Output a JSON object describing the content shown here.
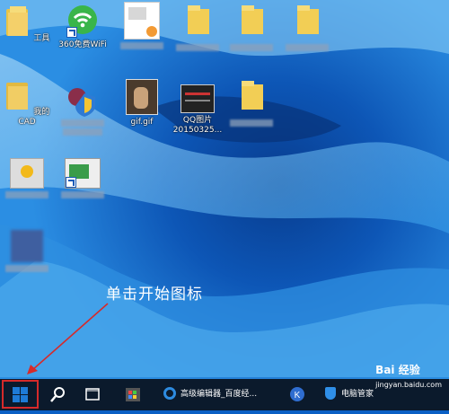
{
  "desktop": {
    "icons": [
      {
        "name": "folder-gongju",
        "label": "工具"
      },
      {
        "name": "wifi-360",
        "label": "360免费WiFi"
      },
      {
        "name": "my-cad",
        "label": "我的CAD"
      },
      {
        "name": "gif-file",
        "label": "gif.gif"
      },
      {
        "name": "qq-image",
        "label_line1": "QQ图片",
        "label_line2": "20150325..."
      }
    ]
  },
  "annotation": {
    "text": "单击开始图标"
  },
  "taskbar": {
    "browser_tab": "高级编辑器_百度经...",
    "security_tab": "电脑管家"
  },
  "watermark": {
    "text": "Bai 经验",
    "url": "jingyan.baidu.com"
  },
  "colors": {
    "taskbar": "#0b1a2c",
    "highlight": "#d62a2a",
    "windows_blue": "#1e7bd7"
  }
}
